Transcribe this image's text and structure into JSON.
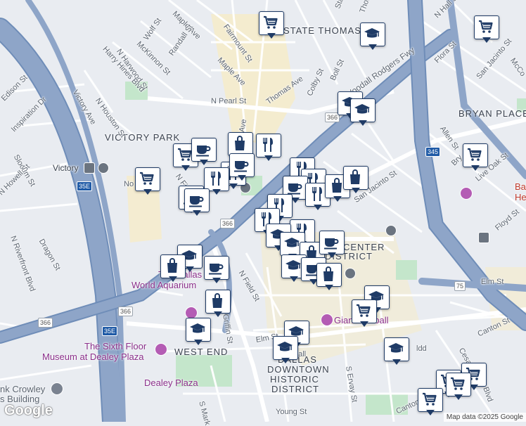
{
  "map": {
    "google_logo": "Google",
    "attribution": "Map data ©2025 Google",
    "colors": {
      "background": "#e9ecf1",
      "freeway": "#8ea5c8",
      "freeway_edge": "#6f8db8",
      "street": "#ffffff",
      "park": "#c4e6cb",
      "downtown_tint": "#f6ecc9",
      "marker_border": "#1f3b66",
      "marker_icon": "#1f3b66",
      "poi": "#8a2f8a"
    },
    "districts": {
      "state_thomas": "STATE THOMAS",
      "victory_park": "VICTORY PARK",
      "bryan_place": "BRYAN PLACE",
      "west_end": "WEST END",
      "center": "CENTER",
      "district": "DISTRICT",
      "downtown_1": "DALLAS",
      "downtown_2": "DOWNTOWN",
      "downtown_3": "HISTORIC",
      "downtown_4": "DISTRICT"
    },
    "pois": {
      "aquarium_1": "The Dallas",
      "aquarium_2": "World Aquarium",
      "sixth_floor_1": "The Sixth Floor",
      "sixth_floor_2": "Museum at Dealey Plaza",
      "dealey": "Dealey Plaza",
      "giant": "Giant",
      "giant_2": "eball",
      "crowley_1": "nk Crowley",
      "crowley_2": "s Building",
      "baylor_1": "Ba",
      "baylor_2": "He"
    },
    "transit": {
      "victory": "Victory"
    },
    "streets": {
      "state_st": "State",
      "thomas_top": "Thomas",
      "maple_ave": "Maple Ave",
      "maple_ave_2": "Maple Ave",
      "wolf_st": "Wolf St",
      "randall_st": "Randall St",
      "n_harwood_st": "N Harwood St",
      "mckinnon_st": "McKinnon St",
      "harry_hines": "Harry Hines Blvd",
      "fairmount_st": "Fairmount St",
      "n_hall_st": "N Hall St",
      "flora_st": "Flora St",
      "san_jacinto_top": "San Jacinto St",
      "mcco": "McCo",
      "edison_st": "Edison St",
      "victory_ave": "Victory Ave",
      "n_houston_st": "N Houston St",
      "inspiration_dr": "Inspiration Dr",
      "n_pearl_st": "N Pearl St",
      "thomas_ave": "Thomas Ave",
      "colby_st": "Colby St",
      "boll_st": "Boll St",
      "woodall": "Woodall Rodgers Fwy",
      "ave": "Ave",
      "slocum_st": "Slocum St",
      "n_howell_st": "N Howell St",
      "n_riverfront": "N Riverfront Blvd",
      "dragon_st": "Dragon St",
      "no": "No",
      "n_fi": "N Fi",
      "san_jacinto": "San Jacinto St",
      "allen_st": "Allen St",
      "live_oak_st": "Live Oak St",
      "floyd_st": "Floyd St",
      "bry": "Bry",
      "n_field_st": "N Field St",
      "n_griffin_st": "N Griffin St",
      "elm_st": "Elm St",
      "elm_st_2": "Elm St",
      "canton_st": "Canton St",
      "cesar": "Cesar Ch",
      "s_ervay_st": "S Ervay St",
      "s_mark": "S Mark",
      "young_st": "Young St",
      "canton_2": "Canton",
      "ldd": "ldd",
      "blvd": "Blvd",
      "dall": "dall"
    },
    "shields": {
      "r366_a": "366",
      "r366_b": "366",
      "r366_c": "366",
      "r366_d": "366",
      "r366_e": "366",
      "i35e_a": "35E",
      "i35e_b": "35E",
      "i345": "345",
      "r75": "75"
    }
  }
}
